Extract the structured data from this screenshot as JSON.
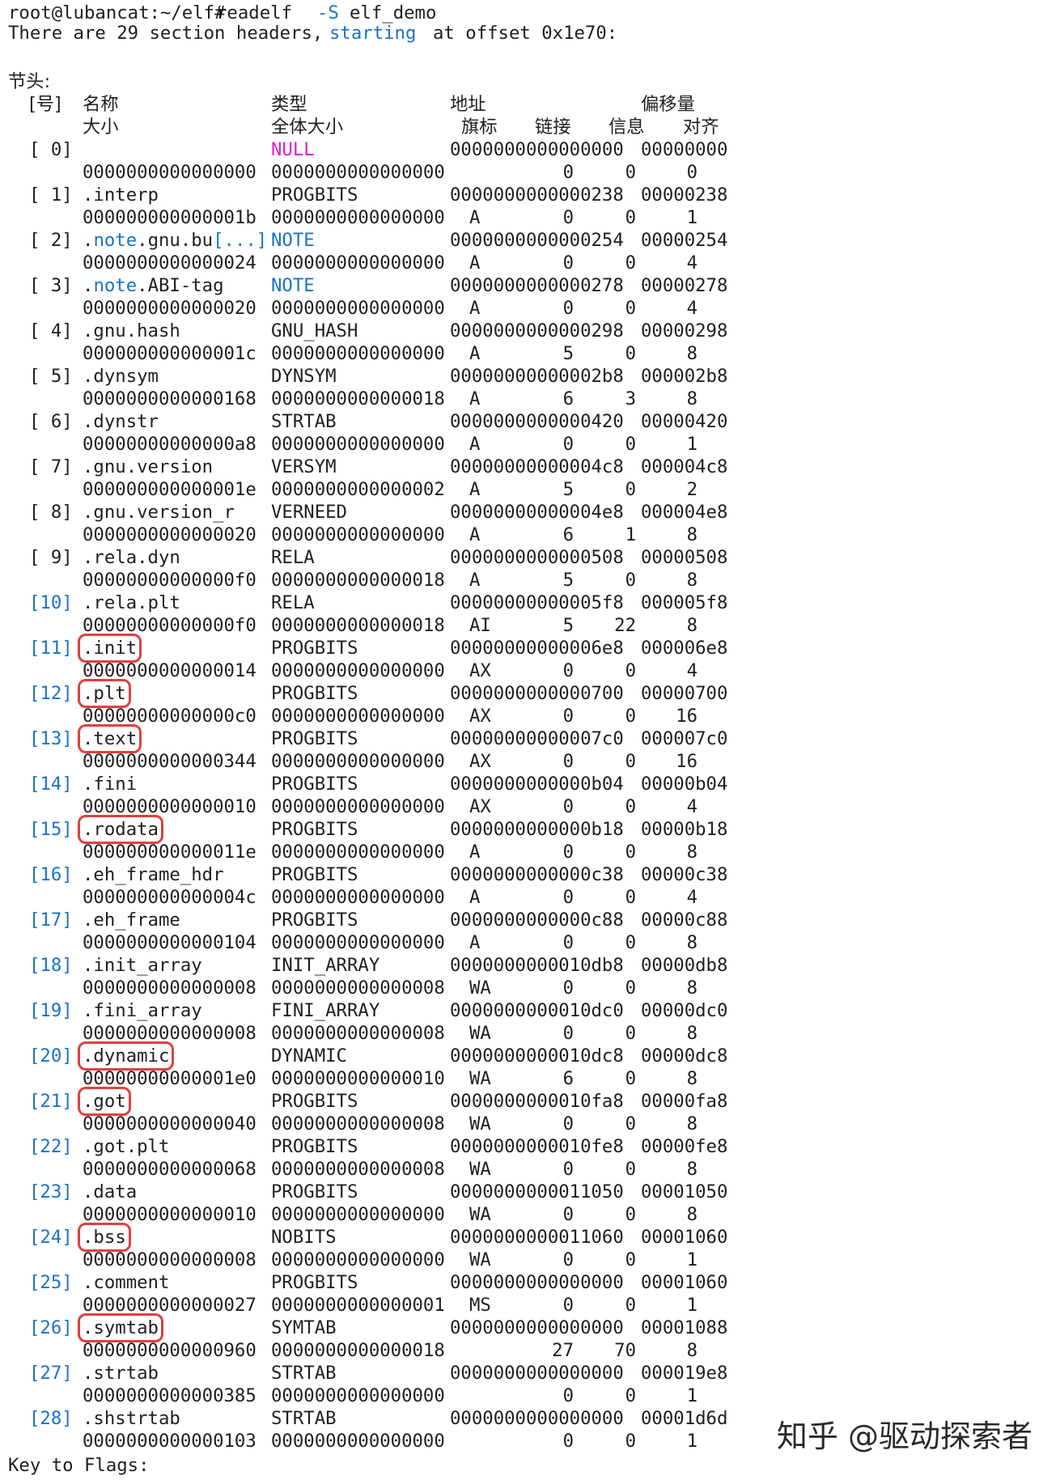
{
  "prompt": "root@lubancat:~/elf#",
  "command": {
    "name": "readelf",
    "flag": "-S",
    "arg": "elf_demo"
  },
  "summary": {
    "pre": "There are 29 section headers,",
    "blue": "starting",
    "post": "at offset 0x1e70:"
  },
  "section_title": "节头:",
  "headers": {
    "l1": [
      "[号]",
      "名称",
      "类型",
      "地址",
      "偏移量"
    ],
    "l2": [
      "大小",
      "全体大小",
      "旗标",
      "链接",
      "信息",
      "对齐"
    ]
  },
  "sections": [
    {
      "nr": "[ 0]",
      "name": "",
      "type": "NULL",
      "addr": "0000000000000000",
      "off": "00000000",
      "size": "0000000000000000",
      "entsize": "0000000000000000",
      "flags": "",
      "link": "0",
      "info": "0",
      "align": "0"
    },
    {
      "nr": "[ 1]",
      "name": ".interp",
      "type": "PROGBITS",
      "addr": "0000000000000238",
      "off": "00000238",
      "size": "000000000000001b",
      "entsize": "0000000000000000",
      "flags": "A",
      "link": "0",
      "info": "0",
      "align": "1"
    },
    {
      "nr": "[ 2]",
      "name": ".note.gnu.bu[...]",
      "type": "NOTE",
      "addr": "0000000000000254",
      "off": "00000254",
      "size": "0000000000000024",
      "entsize": "0000000000000000",
      "flags": "A",
      "link": "0",
      "info": "0",
      "align": "4"
    },
    {
      "nr": "[ 3]",
      "name": ".note.ABI-tag",
      "type": "NOTE",
      "addr": "0000000000000278",
      "off": "00000278",
      "size": "0000000000000020",
      "entsize": "0000000000000000",
      "flags": "A",
      "link": "0",
      "info": "0",
      "align": "4"
    },
    {
      "nr": "[ 4]",
      "name": ".gnu.hash",
      "type": "GNU_HASH",
      "addr": "0000000000000298",
      "off": "00000298",
      "size": "000000000000001c",
      "entsize": "0000000000000000",
      "flags": "A",
      "link": "5",
      "info": "0",
      "align": "8"
    },
    {
      "nr": "[ 5]",
      "name": ".dynsym",
      "type": "DYNSYM",
      "addr": "00000000000002b8",
      "off": "000002b8",
      "size": "0000000000000168",
      "entsize": "0000000000000018",
      "flags": "A",
      "link": "6",
      "info": "3",
      "align": "8"
    },
    {
      "nr": "[ 6]",
      "name": ".dynstr",
      "type": "STRTAB",
      "addr": "0000000000000420",
      "off": "00000420",
      "size": "00000000000000a8",
      "entsize": "0000000000000000",
      "flags": "A",
      "link": "0",
      "info": "0",
      "align": "1"
    },
    {
      "nr": "[ 7]",
      "name": ".gnu.version",
      "type": "VERSYM",
      "addr": "00000000000004c8",
      "off": "000004c8",
      "size": "000000000000001e",
      "entsize": "0000000000000002",
      "flags": "A",
      "link": "5",
      "info": "0",
      "align": "2"
    },
    {
      "nr": "[ 8]",
      "name": ".gnu.version_r",
      "type": "VERNEED",
      "addr": "00000000000004e8",
      "off": "000004e8",
      "size": "0000000000000020",
      "entsize": "0000000000000000",
      "flags": "A",
      "link": "6",
      "info": "1",
      "align": "8"
    },
    {
      "nr": "[ 9]",
      "name": ".rela.dyn",
      "type": "RELA",
      "addr": "0000000000000508",
      "off": "00000508",
      "size": "00000000000000f0",
      "entsize": "0000000000000018",
      "flags": "A",
      "link": "5",
      "info": "0",
      "align": "8"
    },
    {
      "nr": "[10]",
      "name": ".rela.plt",
      "type": "RELA",
      "addr": "00000000000005f8",
      "off": "000005f8",
      "size": "00000000000000f0",
      "entsize": "0000000000000018",
      "flags": "AI",
      "link": "5",
      "info": "22",
      "align": "8"
    },
    {
      "nr": "[11]",
      "name": ".init",
      "type": "PROGBITS",
      "addr": "00000000000006e8",
      "off": "000006e8",
      "size": "0000000000000014",
      "entsize": "0000000000000000",
      "flags": "AX",
      "link": "0",
      "info": "0",
      "align": "4"
    },
    {
      "nr": "[12]",
      "name": ".plt",
      "type": "PROGBITS",
      "addr": "0000000000000700",
      "off": "00000700",
      "size": "00000000000000c0",
      "entsize": "0000000000000000",
      "flags": "AX",
      "link": "0",
      "info": "0",
      "align": "16"
    },
    {
      "nr": "[13]",
      "name": ".text",
      "type": "PROGBITS",
      "addr": "00000000000007c0",
      "off": "000007c0",
      "size": "0000000000000344",
      "entsize": "0000000000000000",
      "flags": "AX",
      "link": "0",
      "info": "0",
      "align": "16"
    },
    {
      "nr": "[14]",
      "name": ".fini",
      "type": "PROGBITS",
      "addr": "0000000000000b04",
      "off": "00000b04",
      "size": "0000000000000010",
      "entsize": "0000000000000000",
      "flags": "AX",
      "link": "0",
      "info": "0",
      "align": "4"
    },
    {
      "nr": "[15]",
      "name": ".rodata",
      "type": "PROGBITS",
      "addr": "0000000000000b18",
      "off": "00000b18",
      "size": "000000000000011e",
      "entsize": "0000000000000000",
      "flags": "A",
      "link": "0",
      "info": "0",
      "align": "8"
    },
    {
      "nr": "[16]",
      "name": ".eh_frame_hdr",
      "type": "PROGBITS",
      "addr": "0000000000000c38",
      "off": "00000c38",
      "size": "000000000000004c",
      "entsize": "0000000000000000",
      "flags": "A",
      "link": "0",
      "info": "0",
      "align": "4"
    },
    {
      "nr": "[17]",
      "name": ".eh_frame",
      "type": "PROGBITS",
      "addr": "0000000000000c88",
      "off": "00000c88",
      "size": "0000000000000104",
      "entsize": "0000000000000000",
      "flags": "A",
      "link": "0",
      "info": "0",
      "align": "8"
    },
    {
      "nr": "[18]",
      "name": ".init_array",
      "type": "INIT_ARRAY",
      "addr": "0000000000010db8",
      "off": "00000db8",
      "size": "0000000000000008",
      "entsize": "0000000000000008",
      "flags": "WA",
      "link": "0",
      "info": "0",
      "align": "8"
    },
    {
      "nr": "[19]",
      "name": ".fini_array",
      "type": "FINI_ARRAY",
      "addr": "0000000000010dc0",
      "off": "00000dc0",
      "size": "0000000000000008",
      "entsize": "0000000000000008",
      "flags": "WA",
      "link": "0",
      "info": "0",
      "align": "8"
    },
    {
      "nr": "[20]",
      "name": ".dynamic",
      "type": "DYNAMIC",
      "addr": "0000000000010dc8",
      "off": "00000dc8",
      "size": "00000000000001e0",
      "entsize": "0000000000000010",
      "flags": "WA",
      "link": "6",
      "info": "0",
      "align": "8"
    },
    {
      "nr": "[21]",
      "name": ".got",
      "type": "PROGBITS",
      "addr": "0000000000010fa8",
      "off": "00000fa8",
      "size": "0000000000000040",
      "entsize": "0000000000000008",
      "flags": "WA",
      "link": "0",
      "info": "0",
      "align": "8"
    },
    {
      "nr": "[22]",
      "name": ".got.plt",
      "type": "PROGBITS",
      "addr": "0000000000010fe8",
      "off": "00000fe8",
      "size": "0000000000000068",
      "entsize": "0000000000000008",
      "flags": "WA",
      "link": "0",
      "info": "0",
      "align": "8"
    },
    {
      "nr": "[23]",
      "name": ".data",
      "type": "PROGBITS",
      "addr": "0000000000011050",
      "off": "00001050",
      "size": "0000000000000010",
      "entsize": "0000000000000000",
      "flags": "WA",
      "link": "0",
      "info": "0",
      "align": "8"
    },
    {
      "nr": "[24]",
      "name": ".bss",
      "type": "NOBITS",
      "addr": "0000000000011060",
      "off": "00001060",
      "size": "0000000000000008",
      "entsize": "0000000000000000",
      "flags": "WA",
      "link": "0",
      "info": "0",
      "align": "1"
    },
    {
      "nr": "[25]",
      "name": ".comment",
      "type": "PROGBITS",
      "addr": "0000000000000000",
      "off": "00001060",
      "size": "0000000000000027",
      "entsize": "0000000000000001",
      "flags": "MS",
      "link": "0",
      "info": "0",
      "align": "1"
    },
    {
      "nr": "[26]",
      "name": ".symtab",
      "type": "SYMTAB",
      "addr": "0000000000000000",
      "off": "00001088",
      "size": "0000000000000960",
      "entsize": "0000000000000018",
      "flags": "",
      "link": "27",
      "info": "70",
      "align": "8"
    },
    {
      "nr": "[27]",
      "name": ".strtab",
      "type": "STRTAB",
      "addr": "0000000000000000",
      "off": "000019e8",
      "size": "0000000000000385",
      "entsize": "0000000000000000",
      "flags": "",
      "link": "0",
      "info": "0",
      "align": "1"
    },
    {
      "nr": "[28]",
      "name": ".shstrtab",
      "type": "STRTAB",
      "addr": "0000000000000000",
      "off": "00001d6d",
      "size": "0000000000000103",
      "entsize": "0000000000000000",
      "flags": "",
      "link": "0",
      "info": "0",
      "align": "1"
    }
  ],
  "highlighted_sections": [
    ".init",
    ".plt",
    ".text",
    ".rodata",
    ".dynamic",
    ".got",
    ".bss",
    ".symtab"
  ],
  "blue_index_from": 10,
  "footer": "Key to Flags:",
  "watermark": "知乎 @驱动探索者",
  "colors": {
    "accent_blue": "#1a73c7",
    "null_magenta": "#e01bd8",
    "highlight_red": "#e0403e"
  }
}
